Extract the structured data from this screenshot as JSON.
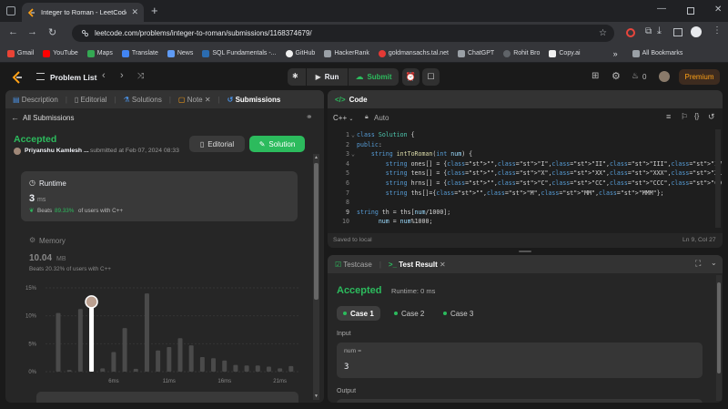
{
  "browser": {
    "tab_title": "Integer to Roman - LeetCode",
    "url": "leetcode.com/problems/integer-to-roman/submissions/1168374679/",
    "bookmarks": [
      "Gmail",
      "YouTube",
      "Maps",
      "Translate",
      "News",
      "SQL Fundamentals -...",
      "GitHub",
      "HackerRank",
      "goldmansachs.tal.net",
      "ChatGPT",
      "Rohit Bro",
      "Copy.ai"
    ],
    "all_bookmarks": "All Bookmarks",
    "more": "»"
  },
  "header": {
    "problem_list": "Problem List",
    "run": "Run",
    "submit": "Submit",
    "fire_count": "0",
    "premium": "Premium"
  },
  "left_tabs": {
    "description": "Description",
    "editorial": "Editorial",
    "solutions": "Solutions",
    "note": "Note",
    "submissions": "Submissions"
  },
  "submission": {
    "back": "All Submissions",
    "status": "Accepted",
    "user": "Priyanshu Kamlesh ...",
    "submitted": "submitted at Feb 07, 2024 08:33",
    "editorial_btn": "Editorial",
    "solution_btn": "Solution",
    "runtime_label": "Runtime",
    "runtime_value": "3",
    "runtime_unit": "ms",
    "runtime_beats_prefix": "Beats",
    "runtime_beats": "89.33%",
    "runtime_beats_suffix": "of users with C++",
    "memory_label": "Memory",
    "memory_value": "10.04",
    "memory_unit": "MB",
    "memory_beats": "Beats 20.32% of users with C++"
  },
  "chart_data": {
    "type": "bar",
    "yticks": [
      "15%",
      "10%",
      "5%",
      "0%"
    ],
    "xticks": [
      "6ms",
      "11ms",
      "16ms",
      "21ms"
    ],
    "ylim": [
      0,
      15
    ],
    "values": [
      10.5,
      0.3,
      11.2,
      12.5,
      0.6,
      3.5,
      7.8,
      0.5,
      14.0,
      3.8,
      4.4,
      6.0,
      4.7,
      2.6,
      2.4,
      2.0,
      1.2,
      1.1,
      1.1,
      0.9,
      0.6,
      1.0
    ],
    "highlight_index": 3
  },
  "editor": {
    "title": "Code",
    "language": "C++",
    "auto": "Auto",
    "status": "Saved to local",
    "position": "Ln 9, Col 27",
    "lines": [
      {
        "n": "1",
        "text": "class Solution {"
      },
      {
        "n": "2",
        "text": "public:"
      },
      {
        "n": "3",
        "text": "    string intToRoman(int num) {"
      },
      {
        "n": "4",
        "text": "        string ones[] = {\"\",\"I\",\"II\",\"III\",\"IV\",\"V\",\"VI\",\"VII\",\"VIII\",\"IX\"};"
      },
      {
        "n": "5",
        "text": "        string tens[] = {\"\",\"X\",\"XX\",\"XXX\",\"XL\",\"L\",\"LX\",\"LXX\",\"LXXX\",\"XC\"};"
      },
      {
        "n": "6",
        "text": "        string hrns[] = {\"\",\"C\",\"CC\",\"CCC\",\"CD\",\"D\",\"DC\",\"DCC\",\"DCCC\",\"CM\"};"
      },
      {
        "n": "7",
        "text": "        string ths[]={\"\",\"M\",\"MM\",\"MMM\"};"
      },
      {
        "n": "8",
        "text": ""
      },
      {
        "n": "9",
        "text": "string th = ths[num/1000];"
      },
      {
        "n": "10",
        "text": "      num = num%1000;"
      }
    ]
  },
  "result": {
    "testcase_tab": "Testcase",
    "result_tab": "Test Result",
    "status": "Accepted",
    "runtime": "Runtime: 0 ms",
    "cases": [
      "Case 1",
      "Case 2",
      "Case 3"
    ],
    "input_label": "Input",
    "var_name": "num =",
    "var_value": "3",
    "output_label": "Output"
  },
  "colors": {
    "accent_green": "#2cbb5d",
    "chart_highlight": "#ffffff",
    "premium_bg": "#3d2b1f",
    "premium_text": "#ffa116"
  }
}
